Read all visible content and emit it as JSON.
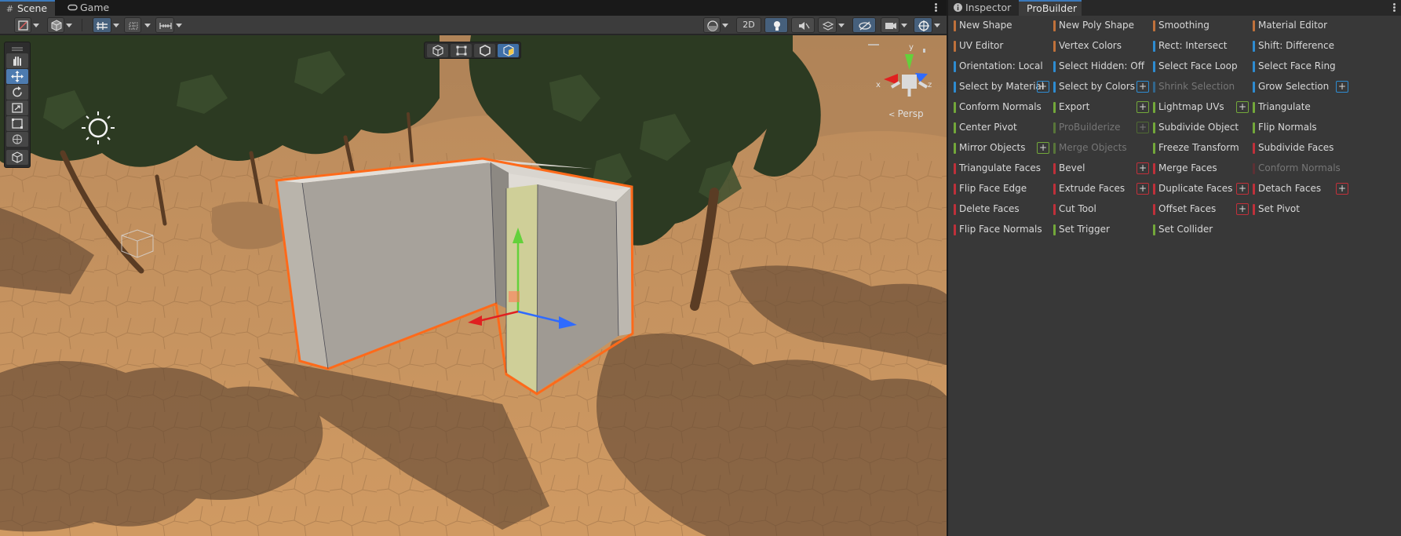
{
  "scene_tabs": {
    "scene_label": "Scene",
    "game_label": "Game",
    "scene_icon": "grid-icon",
    "game_icon": "gamepad-icon"
  },
  "scene_toolbar": {
    "mode_2d_label": "2D"
  },
  "viewport": {
    "projection_label": "Persp",
    "gizmo_axes": {
      "x": "x",
      "y": "y",
      "z": "z"
    }
  },
  "right_tabs": {
    "inspector_label": "Inspector",
    "probuilder_label": "ProBuilder",
    "inspector_icon": "info-icon"
  },
  "colors": {
    "orange": "#c0713b",
    "blue": "#2e8cd1",
    "green": "#73a83a",
    "red": "#c0303a",
    "selection_outline": "#ff6a1a",
    "sand": "#c9935b"
  },
  "probuilder": {
    "rows": [
      [
        {
          "label": "New Shape",
          "color": "orange"
        },
        {
          "label": "New Poly Shape",
          "color": "orange"
        },
        {
          "label": "Smoothing",
          "color": "orange"
        },
        {
          "label": "Material Editor",
          "color": "orange"
        }
      ],
      [
        {
          "label": "UV Editor",
          "color": "orange"
        },
        {
          "label": "Vertex Colors",
          "color": "orange"
        },
        {
          "label": "Rect: Intersect",
          "color": "blue"
        },
        {
          "label": "Shift: Difference",
          "color": "blue"
        }
      ],
      [
        {
          "label": "Orientation: Local",
          "color": "blue"
        },
        {
          "label": "Select Hidden: Off",
          "color": "blue"
        },
        {
          "label": "Select Face Loop",
          "color": "blue"
        },
        {
          "label": "Select Face Ring",
          "color": "blue"
        }
      ],
      [
        {
          "label": "Select by Material",
          "color": "blue",
          "plus": "+"
        },
        {
          "label": "Select by Colors",
          "color": "blue",
          "plus": "+"
        },
        {
          "label": "Shrink Selection",
          "color": "blue",
          "disabled": true
        },
        {
          "label": "Grow Selection",
          "color": "blue",
          "plus": "+"
        }
      ],
      [
        {
          "label": "Conform Normals",
          "color": "green"
        },
        {
          "label": "Export",
          "color": "green",
          "plus": "+"
        },
        {
          "label": "Lightmap UVs",
          "color": "green",
          "plus": "+"
        },
        {
          "label": "Triangulate",
          "color": "green"
        }
      ],
      [
        {
          "label": "Center Pivot",
          "color": "green"
        },
        {
          "label": "ProBuilderize",
          "color": "green",
          "disabled": true,
          "plus": "+"
        },
        {
          "label": "Subdivide Object",
          "color": "green"
        },
        {
          "label": "Flip Normals",
          "color": "green"
        }
      ],
      [
        {
          "label": "Mirror Objects",
          "color": "green",
          "plus": "+"
        },
        {
          "label": "Merge Objects",
          "color": "green",
          "disabled": true
        },
        {
          "label": "Freeze Transform",
          "color": "green"
        },
        {
          "label": "Subdivide Faces",
          "color": "red"
        }
      ],
      [
        {
          "label": "Triangulate Faces",
          "color": "red"
        },
        {
          "label": "Bevel",
          "color": "red",
          "plus": "+"
        },
        {
          "label": "Merge Faces",
          "color": "red"
        },
        {
          "label": "Conform Normals",
          "color": "red",
          "disabled": true
        }
      ],
      [
        {
          "label": "Flip Face Edge",
          "color": "red"
        },
        {
          "label": "Extrude Faces",
          "color": "red",
          "plus": "+"
        },
        {
          "label": "Duplicate Faces",
          "color": "red",
          "plus": "+"
        },
        {
          "label": "Detach Faces",
          "color": "red",
          "plus": "+"
        }
      ],
      [
        {
          "label": "Delete Faces",
          "color": "red"
        },
        {
          "label": "Cut Tool",
          "color": "red"
        },
        {
          "label": "Offset Faces",
          "color": "red",
          "plus": "+"
        },
        {
          "label": "Set Pivot",
          "color": "red"
        }
      ],
      [
        {
          "label": "Flip Face Normals",
          "color": "red"
        },
        {
          "label": "Set Trigger",
          "color": "green"
        },
        {
          "label": "Set Collider",
          "color": "green"
        }
      ]
    ]
  }
}
